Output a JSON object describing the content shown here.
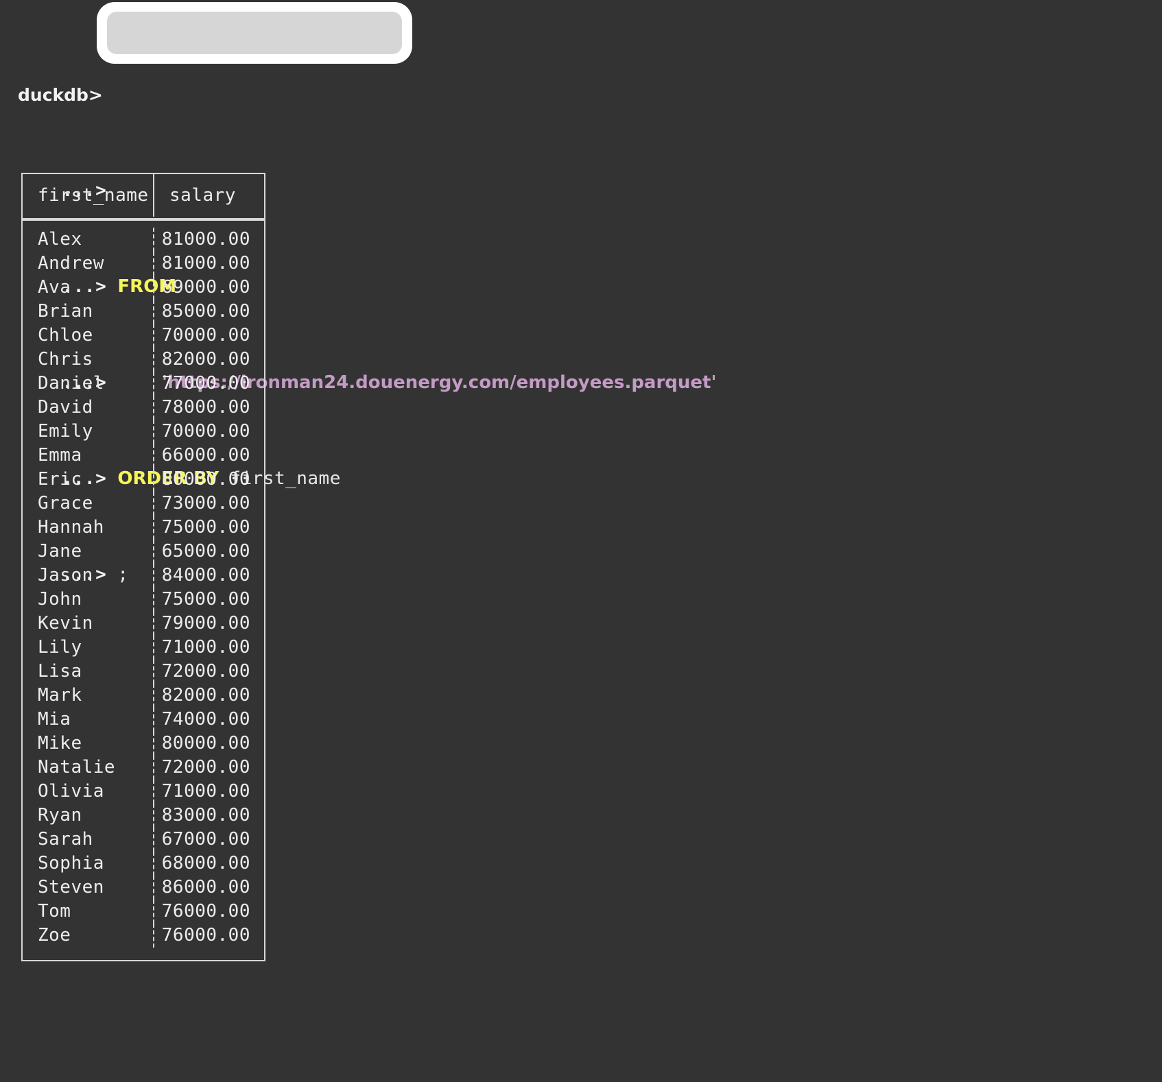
{
  "terminal": {
    "background_color": "#333333",
    "foreground_color": "#e8e8e8",
    "keyword_color": "#f5f55a",
    "string_color": "#c49bc4",
    "prompt_primary": "duckdb>",
    "prompt_continuation": "...>"
  },
  "query": {
    "lines": [
      {
        "prompt": "duckdb>",
        "segments": []
      },
      {
        "prompt": "...>",
        "segments": []
      },
      {
        "prompt": "...>",
        "segments": [
          {
            "text": "FROM",
            "kind": "keyword"
          }
        ]
      },
      {
        "prompt": "...>",
        "segments": [
          {
            "text": "    'https://ironman24.douenergy.com/employees.parquet'",
            "kind": "string"
          }
        ]
      },
      {
        "prompt": "...>",
        "segments": [
          {
            "text": "ORDER BY",
            "kind": "keyword"
          },
          {
            "text": " first_name",
            "kind": "plain"
          }
        ]
      },
      {
        "prompt": "...>",
        "segments": [
          {
            "text": ";",
            "kind": "plain"
          }
        ]
      }
    ],
    "from_keyword": "FROM",
    "source_url": "'https://ironman24.douenergy.com/employees.parquet'",
    "order_by_keyword": "ORDER BY",
    "order_by_column": "first_name",
    "terminator": ";"
  },
  "highlight": {
    "outer_color": "#ffffff",
    "inner_color": "#d6d6d6",
    "covers": "duckdb> prompt input line"
  },
  "result": {
    "columns": [
      "first_name",
      "salary"
    ],
    "rows": [
      [
        "Alex",
        "81000.00"
      ],
      [
        "Andrew",
        "81000.00"
      ],
      [
        "Ava",
        "69000.00"
      ],
      [
        "Brian",
        "85000.00"
      ],
      [
        "Chloe",
        "70000.00"
      ],
      [
        "Chris",
        "82000.00"
      ],
      [
        "Daniel",
        "77000.00"
      ],
      [
        "David",
        "78000.00"
      ],
      [
        "Emily",
        "70000.00"
      ],
      [
        "Emma",
        "66000.00"
      ],
      [
        "Eric",
        "80000.00"
      ],
      [
        "Grace",
        "73000.00"
      ],
      [
        "Hannah",
        "75000.00"
      ],
      [
        "Jane",
        "65000.00"
      ],
      [
        "Jason",
        "84000.00"
      ],
      [
        "John",
        "75000.00"
      ],
      [
        "Kevin",
        "79000.00"
      ],
      [
        "Lily",
        "71000.00"
      ],
      [
        "Lisa",
        "72000.00"
      ],
      [
        "Mark",
        "82000.00"
      ],
      [
        "Mia",
        "74000.00"
      ],
      [
        "Mike",
        "80000.00"
      ],
      [
        "Natalie",
        "72000.00"
      ],
      [
        "Olivia",
        "71000.00"
      ],
      [
        "Ryan",
        "83000.00"
      ],
      [
        "Sarah",
        "67000.00"
      ],
      [
        "Sophia",
        "68000.00"
      ],
      [
        "Steven",
        "86000.00"
      ],
      [
        "Tom",
        "76000.00"
      ],
      [
        "Zoe",
        "76000.00"
      ]
    ]
  }
}
